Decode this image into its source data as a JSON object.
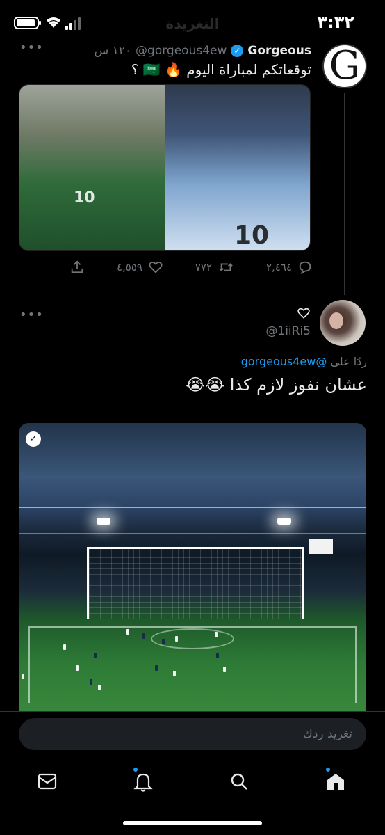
{
  "status_bar": {
    "time": "٣:٣٢",
    "title": "التغريدة"
  },
  "tweet": {
    "display_name": "Gorgeous",
    "handle": "@gorgeous4ew",
    "timestamp": "١٢٠ س",
    "avatar_letter": "G",
    "text": "توقعاتكم لمباراة اليوم 🔥 🇸🇦 ؟",
    "media_jersey_left": "10",
    "media_jersey_right": "10",
    "replies": "٢,٤٦٤",
    "retweets": "٧٧٢",
    "likes": "٤,٥٥٩"
  },
  "reply": {
    "handle": "@1iiRi5",
    "replying_label": "ردًا على",
    "replying_to": "@gorgeous4ew",
    "text": "عشان نفوز لازم كذا 😭😭"
  },
  "composer": {
    "placeholder": "تغريد ردك"
  },
  "bottom_nav": {
    "items": [
      "messages-icon",
      "notifications-icon",
      "search-icon",
      "home-icon"
    ]
  },
  "colors": {
    "accent": "#1d9bf0",
    "background": "#000000",
    "muted": "#71767b"
  }
}
